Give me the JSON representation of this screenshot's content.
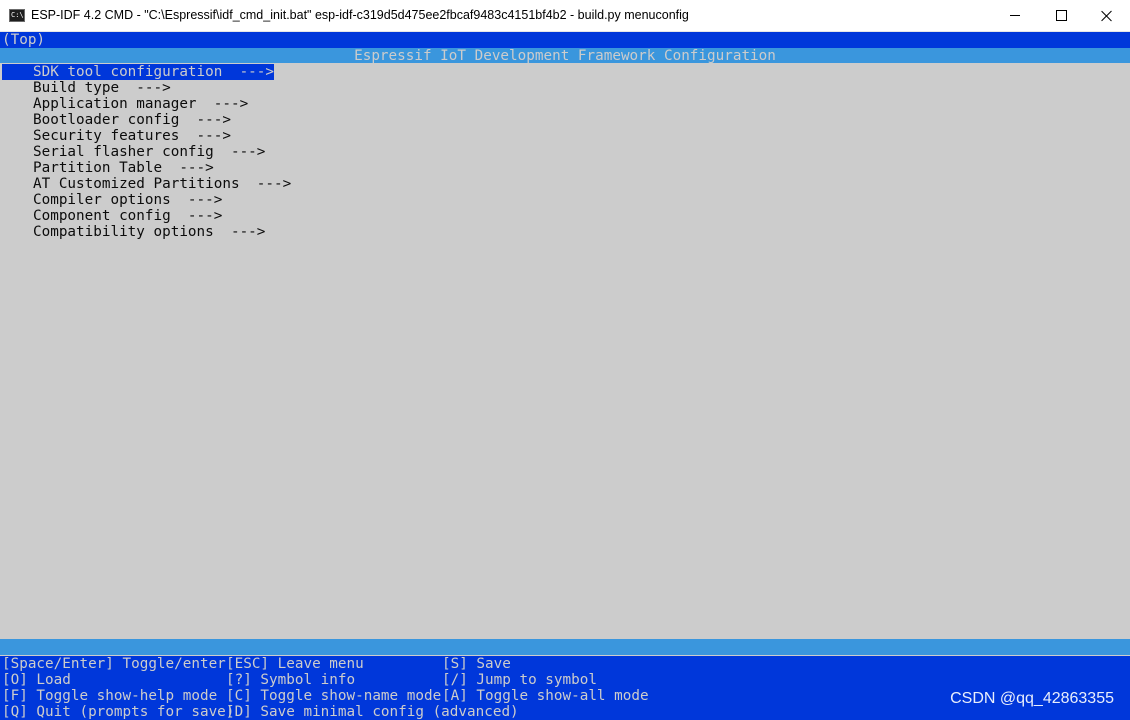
{
  "window": {
    "icon_text": "C:\\",
    "title": "ESP-IDF 4.2 CMD - \"C:\\Espressif\\idf_cmd_init.bat\"  esp-idf-c319d5d475ee2fbcaf9483c4151bf4b2 - build.py  menuconfig"
  },
  "breadcrumb": "(Top)",
  "header": "Espressif IoT Development Framework Configuration",
  "menu": {
    "items": [
      {
        "label": "SDK tool configuration  --->",
        "selected": true
      },
      {
        "label": "Build type  --->"
      },
      {
        "label": "Application manager  --->"
      },
      {
        "label": "Bootloader config  --->"
      },
      {
        "label": "Security features  --->"
      },
      {
        "label": "Serial flasher config  --->"
      },
      {
        "label": "Partition Table  --->"
      },
      {
        "label": "AT Customized Partitions  --->"
      },
      {
        "label": "Compiler options  --->"
      },
      {
        "label": "Component config  --->"
      },
      {
        "label": "Compatibility options  --->"
      }
    ]
  },
  "help": {
    "rows": [
      [
        "[Space/Enter] Toggle/enter",
        "[ESC] Leave menu",
        "[S] Save"
      ],
      [
        "[O] Load",
        "[?] Symbol info",
        "[/] Jump to symbol"
      ],
      [
        "[F] Toggle show-help mode",
        "[C] Toggle show-name mode",
        "[A] Toggle show-all mode"
      ],
      [
        "[Q] Quit (prompts for save)",
        "[D] Save minimal config (advanced)",
        ""
      ]
    ]
  },
  "watermark": "CSDN @qq_42863355",
  "colors": {
    "console_bg": "#cccccc",
    "dark_blue": "#0037da",
    "light_blue": "#3a96dd",
    "text": "#0c0c0c",
    "inverse_text": "#cccccc"
  }
}
